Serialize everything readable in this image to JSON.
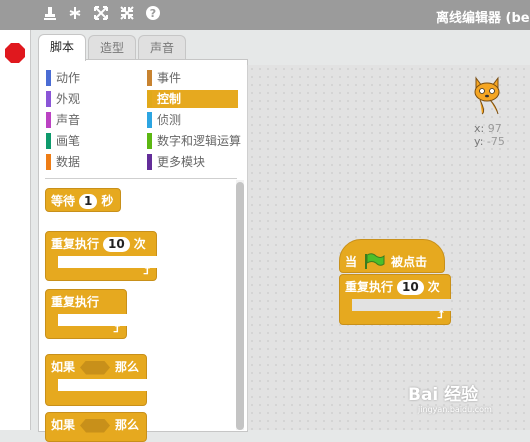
{
  "app": {
    "title": "离线编辑器 (be"
  },
  "toolbar": {
    "icons": [
      "stamp-icon",
      "cut-icon",
      "grow-icon",
      "shrink-icon",
      "help-icon"
    ]
  },
  "tabs": [
    {
      "label": "脚本",
      "active": true
    },
    {
      "label": "造型",
      "active": false
    },
    {
      "label": "声音",
      "active": false
    }
  ],
  "categories": [
    {
      "label": "动作",
      "color": "#4a6cd4"
    },
    {
      "label": "事件",
      "color": "#c88330"
    },
    {
      "label": "外观",
      "color": "#8a55d7"
    },
    {
      "label": "控制",
      "color": "#e1a91a",
      "selected": true
    },
    {
      "label": "声音",
      "color": "#bb42c3"
    },
    {
      "label": "侦测",
      "color": "#2ca5e2"
    },
    {
      "label": "画笔",
      "color": "#0e9a6c"
    },
    {
      "label": "数字和逻辑运算",
      "color": "#5cb712"
    },
    {
      "label": "数据",
      "color": "#ee7d16"
    },
    {
      "label": "更多模块",
      "color": "#632d99"
    }
  ],
  "palette_blocks": {
    "wait": {
      "label": "等待",
      "value": "1",
      "unit": "秒"
    },
    "repeat": {
      "label": "重复执行",
      "value": "10",
      "unit": "次"
    },
    "forever": {
      "label": "重复执行"
    },
    "if1": {
      "label": "如果",
      "then": "那么"
    },
    "if2": {
      "label": "如果",
      "then": "那么"
    }
  },
  "stage": {
    "x_label": "x:",
    "x_value": "97",
    "y_label": "y:",
    "y_value": "-75"
  },
  "script": {
    "hat": {
      "prefix": "当",
      "suffix": "被点击"
    },
    "repeat": {
      "label": "重复执行",
      "value": "10",
      "unit": "次"
    }
  },
  "watermark": {
    "main": "Bai 经验",
    "sub": "jingyan.baidu.com"
  }
}
